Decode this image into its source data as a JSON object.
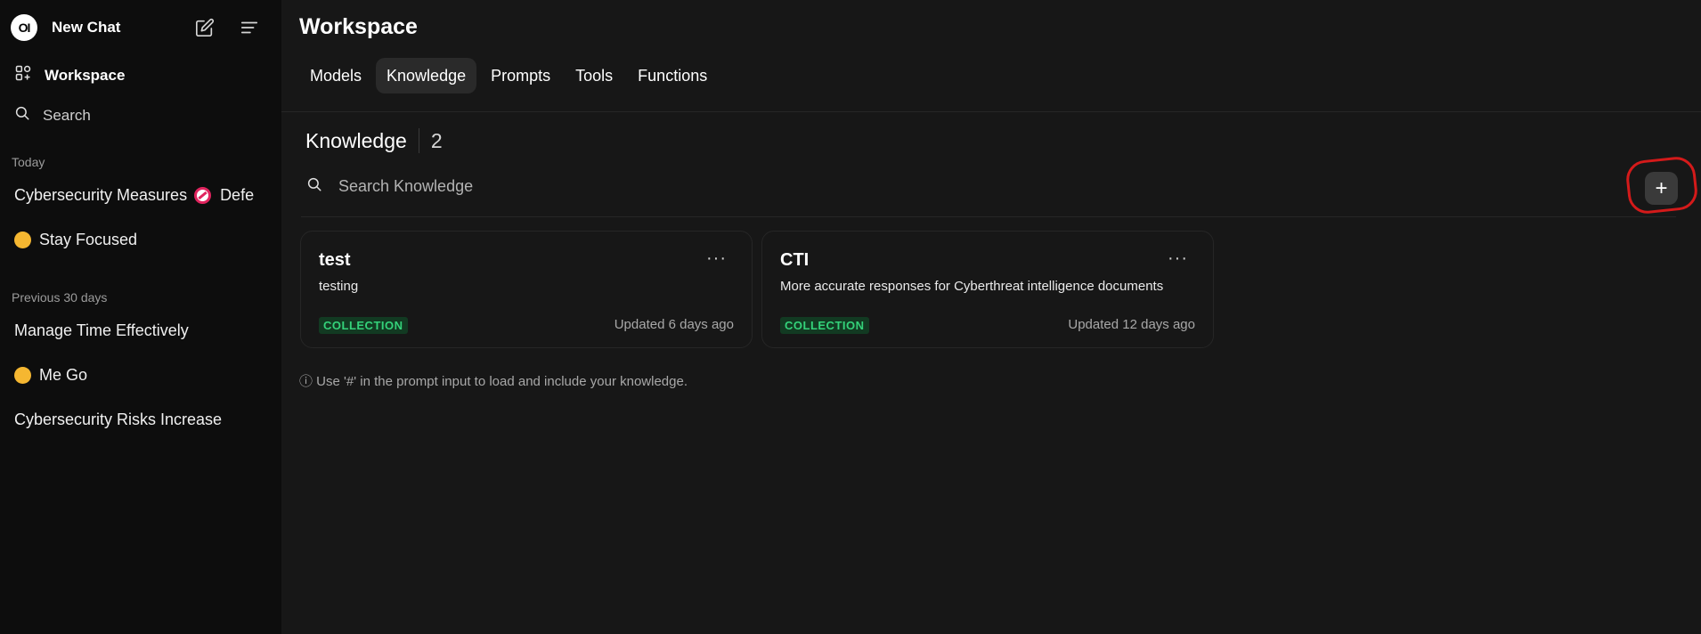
{
  "sidebar": {
    "logo_text": "OI",
    "new_chat_label": "New Chat",
    "workspace_label": "Workspace",
    "search_label": "Search",
    "sections": [
      {
        "heading": "Today",
        "chats": [
          {
            "title": "Cybersecurity Measures",
            "title_suffix": "Defe",
            "emoji": "no-entry"
          },
          {
            "title": "Stay Focused",
            "emoji": "grinning-face"
          }
        ]
      },
      {
        "heading": "Previous 30 days",
        "chats": [
          {
            "title": "Manage Time Effectively"
          },
          {
            "title": "Me Go",
            "emoji": "smiling-face"
          },
          {
            "title": "Cybersecurity Risks Increase"
          }
        ]
      }
    ]
  },
  "header": {
    "title": "Workspace",
    "tabs": [
      "Models",
      "Knowledge",
      "Prompts",
      "Tools",
      "Functions"
    ],
    "active_tab": "Knowledge"
  },
  "knowledge": {
    "title": "Knowledge",
    "count": "2",
    "search_placeholder": "Search Knowledge",
    "add_button": "+",
    "items": [
      {
        "title": "test",
        "description": "testing",
        "badge": "COLLECTION",
        "updated": "Updated 6 days ago",
        "more": "···"
      },
      {
        "title": "CTI",
        "description": "More accurate responses for Cyberthreat intelligence documents",
        "badge": "COLLECTION",
        "updated": "Updated 12 days ago",
        "more": "···"
      }
    ],
    "hint": "ⓘ Use '#' in the prompt input to load and include your knowledge."
  },
  "colors": {
    "background": "#171717",
    "sidebar": "#0d0d0d",
    "badge_bg": "#123a22",
    "badge_text": "#34d27a",
    "annotation_ring": "#d41a1a"
  }
}
